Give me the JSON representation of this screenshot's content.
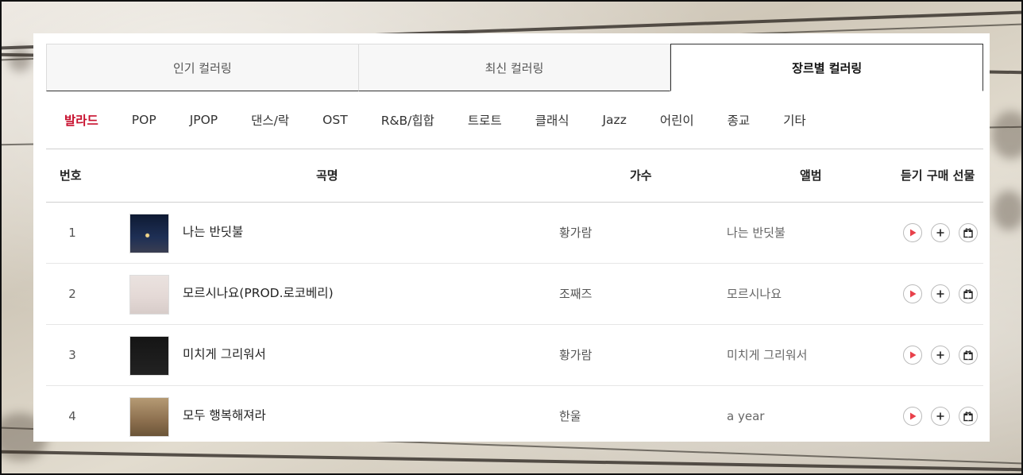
{
  "tabs": [
    {
      "label": "인기 컬러링",
      "active": false
    },
    {
      "label": "최신 컬러링",
      "active": false
    },
    {
      "label": "장르별 컬러링",
      "active": true
    }
  ],
  "genres": [
    "발라드",
    "POP",
    "JPOP",
    "댄스/락",
    "OST",
    "R&B/힙합",
    "트로트",
    "클래식",
    "Jazz",
    "어린이",
    "종교",
    "기타"
  ],
  "active_genre": "발라드",
  "headers": {
    "num": "번호",
    "title": "곡명",
    "artist": "가수",
    "album": "앨범",
    "actions": "듣기 구매 선물"
  },
  "rows": [
    {
      "num": "1",
      "title": "나는 반딧불",
      "artist": "황가람",
      "album": "나는 반딧불"
    },
    {
      "num": "2",
      "title": "모르시나요(PROD.로코베리)",
      "artist": "조째즈",
      "album": "모르시나요"
    },
    {
      "num": "3",
      "title": "미치게 그리워서",
      "artist": "황가람",
      "album": "미치게 그리워서"
    },
    {
      "num": "4",
      "title": "모두 행복해져라",
      "artist": "한울",
      "album": "a year"
    }
  ],
  "colors": {
    "accent": "#c8102e",
    "play": "#e8404a"
  },
  "icons": {
    "play": "play-icon",
    "add": "plus-icon",
    "gift": "gift-icon"
  }
}
